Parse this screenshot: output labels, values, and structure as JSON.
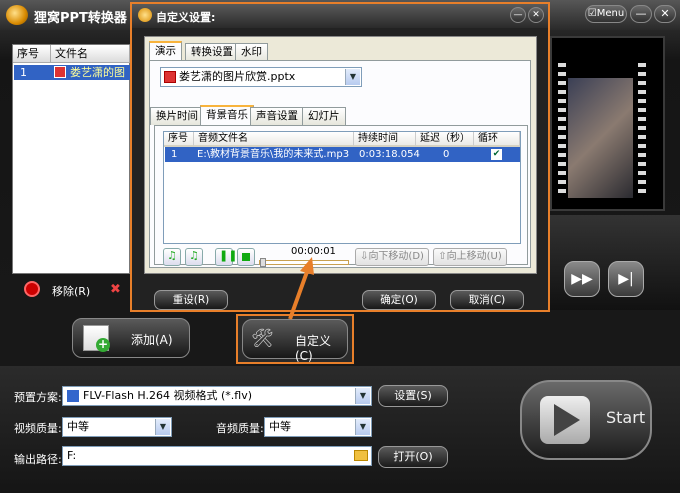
{
  "app": {
    "title": "狸窝PPT转换器",
    "menu_label": "Menu",
    "minimize": "—",
    "close": "✕"
  },
  "file_list": {
    "headers": [
      "序号",
      "文件名"
    ],
    "rows": [
      {
        "index": "1",
        "name": "娄艺潇的图"
      }
    ]
  },
  "left_actions": {
    "remove_label": "移除(R)"
  },
  "buttons": {
    "add_label": "添加(A)",
    "customize_label": "自定义(C)",
    "start_label": "Start"
  },
  "settings": {
    "preset_label": "预置方案:",
    "preset_value": "FLV-Flash H.264 视频格式 (*.flv)",
    "preset_button": "设置(S)",
    "video_quality_label": "视频质量:",
    "video_quality_value": "中等",
    "audio_quality_label": "音频质量:",
    "audio_quality_value": "中等",
    "output_label": "输出路径:",
    "output_value": "F:",
    "open_button": "打开(O)"
  },
  "dialog": {
    "title": "自定义设置:",
    "main_tabs": [
      "演示",
      "转换设置",
      "水印"
    ],
    "active_main_tab": "演示",
    "ppt_file": "娄艺潇的图片欣赏.pptx",
    "sub_tabs": [
      "换片时间",
      "背景音乐",
      "声音设置",
      "幻灯片"
    ],
    "active_sub_tab": "背景音乐",
    "table": {
      "headers": [
        "序号",
        "音频文件名",
        "持续时间",
        "延迟（秒）",
        "循环"
      ],
      "rows": [
        {
          "index": "1",
          "file": "E:\\教材背景音乐\\我的未来式.mp3",
          "duration": "0:03:18.054",
          "delay": "0",
          "loop": "✔"
        }
      ]
    },
    "time_display": "00:00:01",
    "move_down": "向下移动(D)",
    "move_up": "向上移动(U)",
    "reset_button": "重设(R)",
    "ok_button": "确定(O)",
    "cancel_button": "取消(C)"
  },
  "colors": {
    "highlight": "#e87f2a",
    "selection": "#3163c4"
  }
}
